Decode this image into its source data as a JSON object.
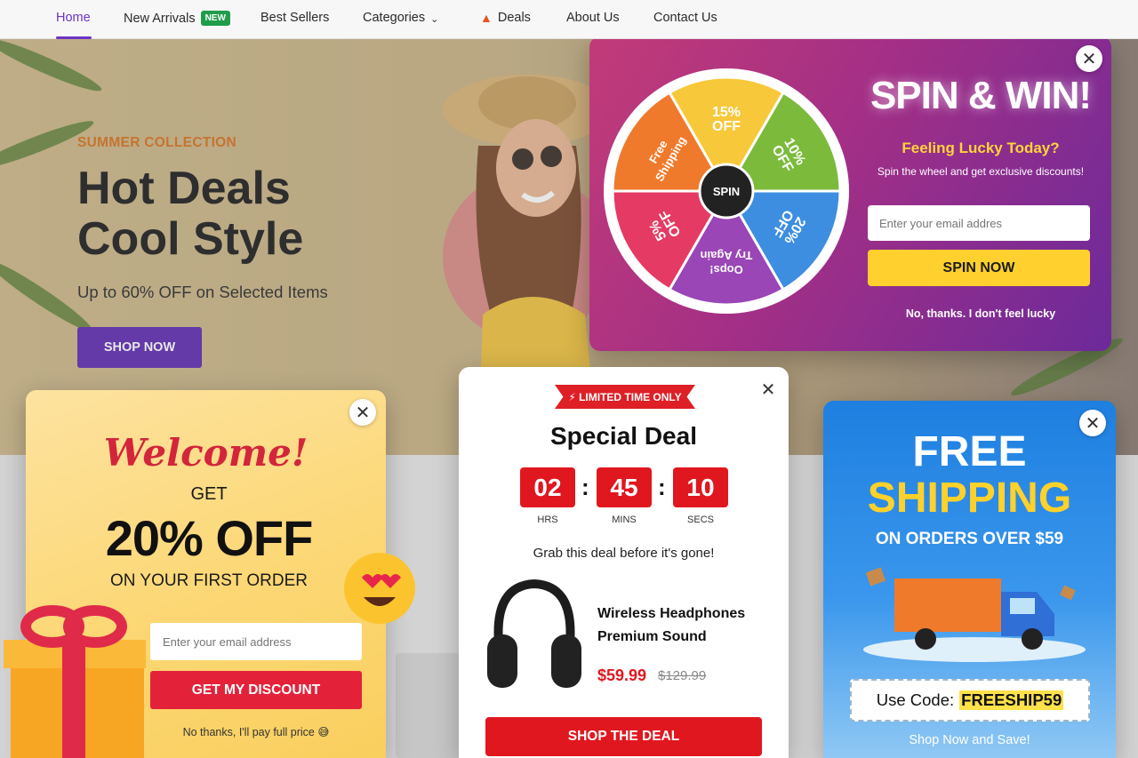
{
  "nav": {
    "items": [
      {
        "label": "Home"
      },
      {
        "label": "New Arrivals",
        "badge": "NEW"
      },
      {
        "label": "Best Sellers"
      },
      {
        "label": "Categories"
      },
      {
        "label": "Deals"
      },
      {
        "label": "About Us"
      },
      {
        "label": "Contact Us"
      }
    ]
  },
  "hero": {
    "collection": "SUMMER COLLECTION",
    "title_line1": "Hot Deals",
    "title_line2": "Cool Style",
    "subtitle": "Up to 60% OFF on Selected Items",
    "button": "SHOP NOW"
  },
  "spin": {
    "title": "SPIN & WIN!",
    "lucky": "Feeling Lucky Today?",
    "description": "Spin the wheel and get exclusive discounts!",
    "email_placeholder": "Enter your email addres",
    "button": "SPIN NOW",
    "decline": "No, thanks. I don't feel lucky",
    "center_label": "SPIN",
    "segments": [
      {
        "line1": "15%",
        "line2": "OFF",
        "color": "#f7c83a"
      },
      {
        "line1": "10%",
        "line2": "OFF",
        "color": "#7cba3c"
      },
      {
        "line1": "20%",
        "line2": "OFF",
        "color": "#3d8ee0"
      },
      {
        "line1": "Oops!",
        "line2": "Try Again",
        "color": "#9a46b6"
      },
      {
        "line1": "5%",
        "line2": "OFF",
        "color": "#e43a63"
      },
      {
        "line1": "Free",
        "line2": "Shipping",
        "color": "#f07a2b"
      }
    ]
  },
  "welcome": {
    "script": "Welcome!",
    "get": "GET",
    "big": "20% OFF",
    "first_order": "ON YOUR FIRST ORDER",
    "email_placeholder": "Enter your email address",
    "button": "GET MY DISCOUNT",
    "decline": "No thanks, I'll pay full price 😅"
  },
  "deal": {
    "ribbon": "LIMITED TIME ONLY",
    "title": "Special Deal",
    "timer": {
      "hours": "02",
      "minutes": "45",
      "seconds": "10"
    },
    "timer_labels": {
      "hours": "HRS",
      "minutes": "MINS",
      "seconds": "SECS"
    },
    "tagline": "Grab this deal before it's gone!",
    "product_line1": "Wireless Headphones",
    "product_line2": "Premium Sound",
    "price": "$59.99",
    "old_price": "$129.99",
    "button": "SHOP THE DEAL"
  },
  "shipping": {
    "line1": "FREE",
    "line2": "SHIPPING",
    "line3": "ON ORDERS OVER $59",
    "code_label": "Use Code:",
    "code": "FREESHIP59",
    "cta": "Shop Now and Save!"
  },
  "colors": {
    "accent_purple": "#6d35c2",
    "deal_red": "#e0171f",
    "spin_yellow": "#ffd02e",
    "shipping_blue": "#1e7fe0"
  }
}
